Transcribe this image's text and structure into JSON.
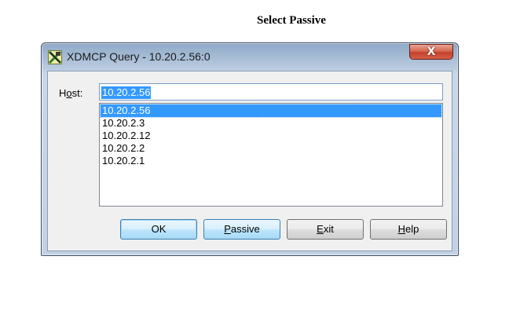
{
  "page": {
    "heading": "Select Passive"
  },
  "window": {
    "title": "XDMCP Query - 10.20.2.56:0",
    "close_label": "X",
    "icon": "xming-x-icon"
  },
  "form": {
    "host_label_prefix": "H",
    "host_label_mnemonic": "o",
    "host_label_suffix": "st:",
    "host_value": "10.20.2.56"
  },
  "host_list": {
    "items": [
      "10.20.2.56",
      "10.20.2.3",
      "10.20.2.12",
      "10.20.2.2",
      "10.20.2.1"
    ],
    "selected": "10.20.2.56"
  },
  "buttons": {
    "ok_label": "OK",
    "passive_mnemonic": "P",
    "passive_rest": "assive",
    "exit_mnemonic": "E",
    "exit_rest": "xit",
    "help_mnemonic": "H",
    "help_rest": "elp"
  },
  "colors": {
    "selection": "#3399ff",
    "close_button": "#c4412b",
    "window_frame": "#b7c9de"
  }
}
